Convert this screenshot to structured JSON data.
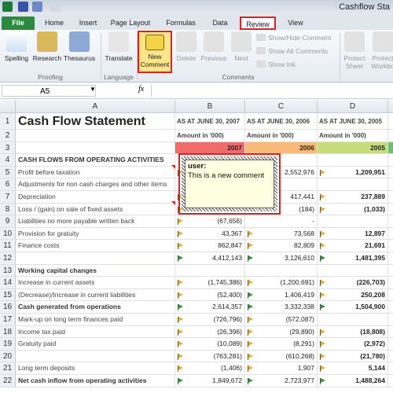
{
  "window": {
    "title": "Cashflow Sta"
  },
  "tabs": [
    "File",
    "Home",
    "Insert",
    "Page Layout",
    "Formulas",
    "Data",
    "Review",
    "View"
  ],
  "selected_tab": "Review",
  "ribbon": {
    "groups": [
      "Proofing",
      "Language",
      "Comments"
    ],
    "buttons": {
      "spelling": "Spelling",
      "research": "Research",
      "thesaurus": "Thesaurus",
      "translate": "Translate",
      "new_comment": [
        "New",
        "Comment"
      ],
      "delete": "Delete",
      "previous": "Previous",
      "next": "Next",
      "protect_sheet": [
        "Protect",
        "Sheet"
      ],
      "protect_workbook": [
        "Protect",
        "Workbo"
      ]
    },
    "small": {
      "show_hide": "Show/Hide Comment",
      "show_all": "Show All Comments",
      "show_ink": "Show Ink"
    }
  },
  "formula_bar": {
    "name_box": "A5",
    "fx": "fx",
    "value": ""
  },
  "columns": [
    "A",
    "B",
    "C",
    "D"
  ],
  "sheet": {
    "title": "Cash Flow Statement",
    "headers": [
      "AS AT JUNE 30, 2007",
      "AS AT JUNE 30, 2006",
      "AS AT JUNE 30, 2005"
    ],
    "amount_label": "Amount in '000)",
    "years": [
      "2007",
      "2006",
      "2005"
    ],
    "year_colors": [
      "#f26b6b",
      "#f9b97a",
      "#c6dc7e"
    ],
    "rows": [
      {
        "n": "4",
        "label": "CASH FLOWS FROM OPERATING ACTIVITIES",
        "bold": true,
        "v": [
          "",
          "",
          ""
        ],
        "f": [
          "",
          "",
          ""
        ]
      },
      {
        "n": "5",
        "label": "Profit before taxation",
        "v": [
          "",
          "2,552,976",
          "1,209,951"
        ],
        "f": [
          "y",
          "",
          "y"
        ]
      },
      {
        "n": "6",
        "label": "Adjustments for non cash charges and other items",
        "v": [
          "",
          "",
          ""
        ],
        "f": [
          "",
          "",
          ""
        ]
      },
      {
        "n": "7",
        "label": "Depreciation",
        "v": [
          "",
          "417,441",
          "237,889"
        ],
        "f": [
          "y",
          "",
          "y"
        ]
      },
      {
        "n": "8",
        "label": "Loss / (gain) on sale of fixed assets",
        "v": [
          "",
          "(184)",
          "(1,033)"
        ],
        "f": [
          "y",
          "",
          "y"
        ]
      },
      {
        "n": "9",
        "label": "Liabilities no more payable written back",
        "v": [
          "(67,656)",
          "-",
          ""
        ],
        "f": [
          "y",
          "",
          ""
        ]
      },
      {
        "n": "10",
        "label": "Provision for gratuity",
        "v": [
          "43,367",
          "73,568",
          "12,897"
        ],
        "f": [
          "y",
          "y",
          "y"
        ]
      },
      {
        "n": "11",
        "label": "Finance costs",
        "v": [
          "862,847",
          "82,809",
          "21,691"
        ],
        "f": [
          "y",
          "y",
          "y"
        ]
      },
      {
        "n": "12",
        "label": "",
        "v": [
          "4,412,143",
          "3,126,610",
          "1,481,395"
        ],
        "f": [
          "g",
          "g",
          "g"
        ]
      },
      {
        "n": "13",
        "label": "Working capital changes",
        "bold": true,
        "v": [
          "",
          "",
          ""
        ],
        "f": [
          "",
          "",
          ""
        ]
      },
      {
        "n": "14",
        "label": "Increase in current assets",
        "v": [
          "(1,745,386)",
          "(1,200,691)",
          "(226,703)"
        ],
        "f": [
          "y",
          "y",
          "y"
        ]
      },
      {
        "n": "15",
        "label": "(Decrease)/Increase in current liabilities",
        "v": [
          "(52,400)",
          "1,406,419",
          "250,208"
        ],
        "f": [
          "y",
          "g",
          "y"
        ]
      },
      {
        "n": "16",
        "label": "Cash generated from operations",
        "bold": true,
        "v": [
          "2,614,357",
          "3,332,338",
          "1,504,900"
        ],
        "f": [
          "g",
          "g",
          "g"
        ]
      },
      {
        "n": "17",
        "label": "Mark-up on long term finances paid",
        "v": [
          "(726,796)",
          "(572,087)",
          ""
        ],
        "f": [
          "y",
          "y",
          ""
        ]
      },
      {
        "n": "18",
        "label": "Income tax paid",
        "v": [
          "(26,396)",
          "(29,890)",
          "(18,808)"
        ],
        "f": [
          "y",
          "y",
          "y"
        ]
      },
      {
        "n": "19",
        "label": "Gratuity paid",
        "v": [
          "(10,089)",
          "(8,291)",
          "(2,972)"
        ],
        "f": [
          "y",
          "y",
          "y"
        ]
      },
      {
        "n": "20",
        "label": "",
        "v": [
          "(763,281)",
          "(610,268)",
          "(21,780)"
        ],
        "f": [
          "y",
          "y",
          "y"
        ]
      },
      {
        "n": "21",
        "label": "Long term deposits",
        "v": [
          "(1,406)",
          "1,907",
          "5,144"
        ],
        "f": [
          "y",
          "y",
          "y"
        ]
      },
      {
        "n": "22",
        "label": "Net cash inflow from operating activities",
        "bold": true,
        "v": [
          "1,849,672",
          "2,723,977",
          "1,488,264"
        ],
        "f": [
          "g",
          "g",
          "g"
        ]
      }
    ]
  },
  "comment": {
    "author": "user:",
    "text": "This is a new comment"
  },
  "colors": {
    "flag_yellow": "#e8b020",
    "flag_green": "#2e9a3a",
    "highlight": "#e0201c"
  }
}
